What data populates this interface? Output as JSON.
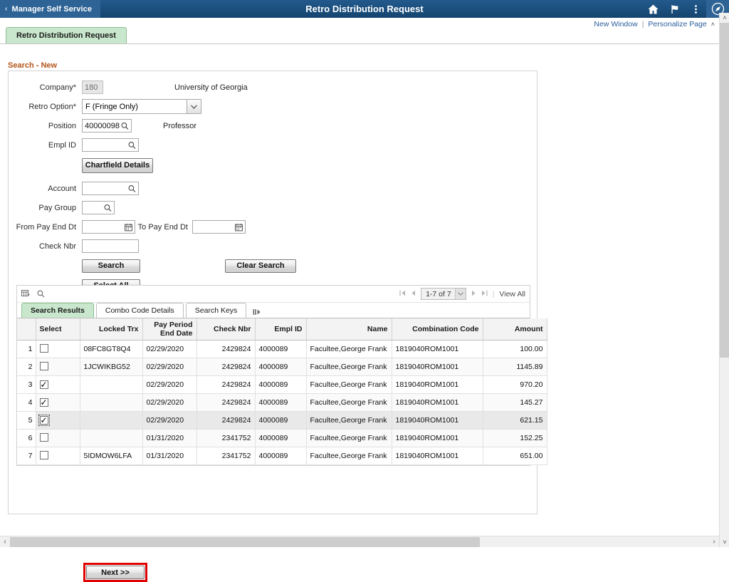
{
  "topbar": {
    "back_label": "Manager Self Service",
    "back_chevron": "‹",
    "title": "Retro Distribution Request",
    "icons": [
      {
        "name": "home-icon"
      },
      {
        "name": "flag-icon"
      },
      {
        "name": "actions-menu-icon"
      },
      {
        "name": "nav-compass-icon"
      }
    ]
  },
  "links": {
    "new_window": "New Window",
    "separator": "|",
    "personalize_page": "Personalize Page",
    "collapse_caret": "˄"
  },
  "page_tab": {
    "label": "Retro Distribution Request"
  },
  "section": {
    "heading": "Search - New"
  },
  "form": {
    "company": {
      "label": "Company*",
      "value": "180",
      "side_text": "University of Georgia"
    },
    "retro_option": {
      "label": "Retro Option*",
      "value": "F (Fringe Only)"
    },
    "position": {
      "label": "Position",
      "value": "40000098",
      "side_text": "Professor"
    },
    "empl_id": {
      "label": "Empl ID",
      "value": ""
    },
    "chartfield_button": "Chartfield Details",
    "account": {
      "label": "Account",
      "value": ""
    },
    "pay_group": {
      "label": "Pay Group",
      "value": ""
    },
    "from_pay_end_dt": {
      "label": "From Pay End Dt",
      "value": ""
    },
    "to_pay_end_dt": {
      "label": "To Pay End Dt",
      "value": ""
    },
    "check_nbr": {
      "label": "Check Nbr",
      "value": ""
    },
    "search_button": "Search",
    "clear_search_button": "Clear Search",
    "select_all_button": "Select All"
  },
  "grid": {
    "toolbar": {
      "personalize_icon": "grid-personalize-icon",
      "find_icon": "find-icon",
      "first_arrow": "⏮",
      "prev_arrow": "◀",
      "page_count": "1-7 of 7",
      "next_arrow": "▶",
      "last_arrow": "⏭",
      "divider": "|",
      "view_all": "View All"
    },
    "tabs": [
      {
        "label": "Search Results",
        "active": true
      },
      {
        "label": "Combo Code Details",
        "active": false
      },
      {
        "label": "Search Keys",
        "active": false
      }
    ],
    "tab_expand_icon": "expand-tabs-icon",
    "columns": [
      "Select",
      "Locked Trx",
      "Pay Period End Date",
      "Check Nbr",
      "Empl ID",
      "Name",
      "Combination Code",
      "Amount"
    ],
    "rows": [
      {
        "idx": "1",
        "selected": false,
        "focused": false,
        "highlight": false,
        "locked_trx": "08FC8GT8Q4",
        "pay_period_end_date": "02/29/2020",
        "check_nbr": "2429824",
        "empl_id": "4000089",
        "name": "Facultee,George Frank",
        "combination_code": "1819040ROM1001",
        "amount": "100.00"
      },
      {
        "idx": "2",
        "selected": false,
        "focused": false,
        "highlight": false,
        "locked_trx": "1JCWIKBG52",
        "pay_period_end_date": "02/29/2020",
        "check_nbr": "2429824",
        "empl_id": "4000089",
        "name": "Facultee,George Frank",
        "combination_code": "1819040ROM1001",
        "amount": "1145.89"
      },
      {
        "idx": "3",
        "selected": true,
        "focused": false,
        "highlight": false,
        "locked_trx": "",
        "pay_period_end_date": "02/29/2020",
        "check_nbr": "2429824",
        "empl_id": "4000089",
        "name": "Facultee,George Frank",
        "combination_code": "1819040ROM1001",
        "amount": "970.20"
      },
      {
        "idx": "4",
        "selected": true,
        "focused": false,
        "highlight": false,
        "locked_trx": "",
        "pay_period_end_date": "02/29/2020",
        "check_nbr": "2429824",
        "empl_id": "4000089",
        "name": "Facultee,George Frank",
        "combination_code": "1819040ROM1001",
        "amount": "145.27"
      },
      {
        "idx": "5",
        "selected": true,
        "focused": true,
        "highlight": true,
        "locked_trx": "",
        "pay_period_end_date": "02/29/2020",
        "check_nbr": "2429824",
        "empl_id": "4000089",
        "name": "Facultee,George Frank",
        "combination_code": "1819040ROM1001",
        "amount": "621.15"
      },
      {
        "idx": "6",
        "selected": false,
        "focused": false,
        "highlight": false,
        "locked_trx": "",
        "pay_period_end_date": "01/31/2020",
        "check_nbr": "2341752",
        "empl_id": "4000089",
        "name": "Facultee,George Frank",
        "combination_code": "1819040ROM1001",
        "amount": "152.25"
      },
      {
        "idx": "7",
        "selected": false,
        "focused": false,
        "highlight": false,
        "locked_trx": "5IDMOW6LFA",
        "pay_period_end_date": "01/31/2020",
        "check_nbr": "2341752",
        "empl_id": "4000089",
        "name": "Facultee,George Frank",
        "combination_code": "1819040ROM1001",
        "amount": "651.00"
      }
    ]
  },
  "footer": {
    "next_button": "Next >>",
    "highlight_color": "#e00000"
  },
  "scrollbars": {
    "v_up": "˄",
    "v_down": "˅",
    "h_left": "‹",
    "h_right": "›"
  },
  "colors": {
    "header_navy": "#1b4f7e",
    "tab_green": "#c9e7cc",
    "heading_orange": "#b35418",
    "link_blue": "#2a5f9e"
  }
}
